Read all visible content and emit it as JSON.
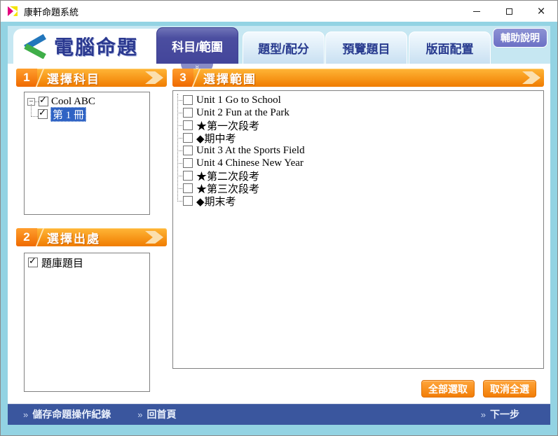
{
  "window": {
    "title": "康軒命題系統"
  },
  "header": {
    "app_title": "電腦命題",
    "help_button": "輔助說明",
    "tabs": [
      {
        "label": "科目/範圍",
        "active": true
      },
      {
        "label": "題型/配分",
        "active": false
      },
      {
        "label": "預覽題目",
        "active": false
      },
      {
        "label": "版面配置",
        "active": false
      }
    ]
  },
  "sections": {
    "subject": {
      "number": "1",
      "title": "選擇科目",
      "tree": {
        "expand_glyph": "−",
        "root_label": "Cool ABC",
        "root_checked": true,
        "child_label": "第 1 冊",
        "child_checked": true,
        "child_selected": true
      }
    },
    "source": {
      "number": "2",
      "title": "選擇出處",
      "items": [
        {
          "label": "題庫題目",
          "checked": true
        }
      ]
    },
    "range": {
      "number": "3",
      "title": "選擇範圍",
      "items": [
        {
          "label": "Unit 1 Go to School",
          "checked": false
        },
        {
          "label": "Unit 2 Fun at the Park",
          "checked": false
        },
        {
          "label": "★第一次段考",
          "checked": false
        },
        {
          "label": "◆期中考",
          "checked": false
        },
        {
          "label": "Unit 3 At the Sports Field",
          "checked": false
        },
        {
          "label": "Unit 4 Chinese New Year",
          "checked": false
        },
        {
          "label": "★第二次段考",
          "checked": false
        },
        {
          "label": "★第三次段考",
          "checked": false
        },
        {
          "label": "◆期末考",
          "checked": false
        }
      ],
      "select_all": "全部選取",
      "deselect_all": "取消全選"
    }
  },
  "footer": {
    "bullet": "»",
    "save_record": "儲存命題操作紀錄",
    "home": "回首頁",
    "next": "下一步"
  },
  "icons": {
    "double_chevron_down": "»"
  },
  "colors": {
    "accent_orange": "#F68B1F",
    "banner_gradient_top": "#FFB637",
    "banner_gradient_bottom": "#F07C00",
    "tab_active": "#4B4EA0",
    "footer_blue": "#3A569E",
    "selection_blue": "#2F63C4",
    "frame_cyan": "#93D3E3",
    "header_band": "#C6E7F2",
    "title_blue": "#2B3990"
  }
}
